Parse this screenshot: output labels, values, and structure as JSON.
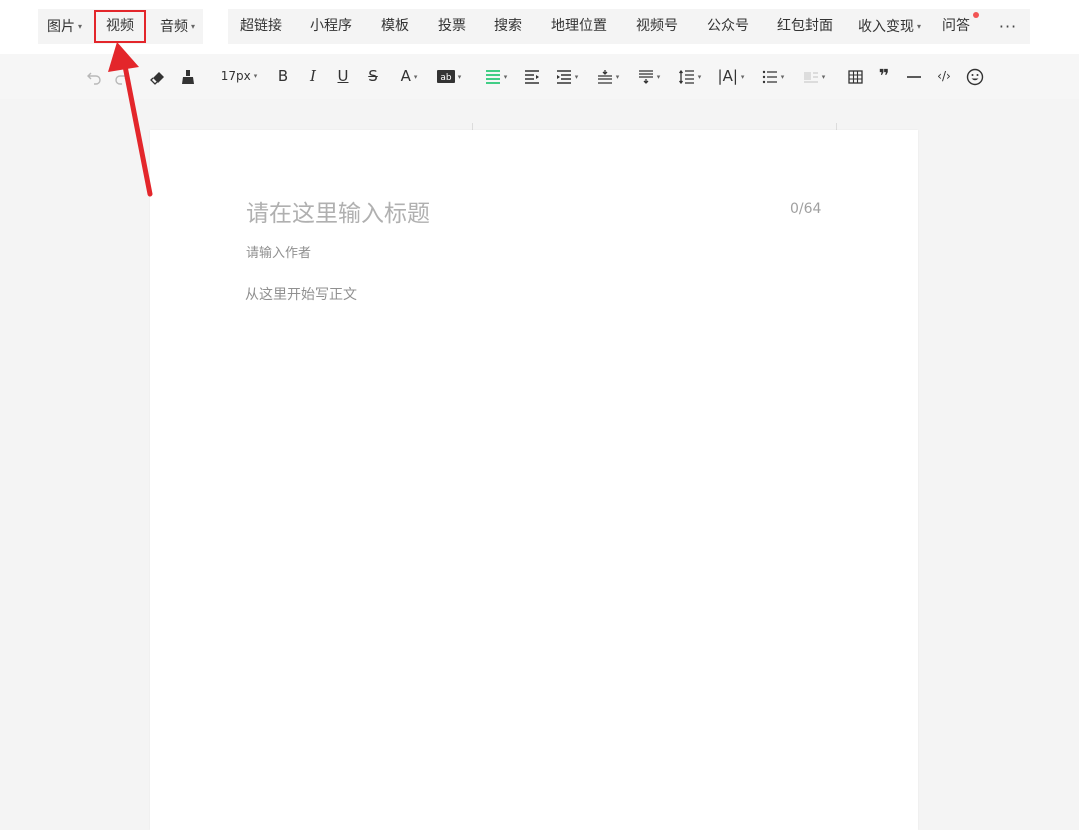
{
  "toolbar": {
    "image": "图片",
    "video": "视频",
    "audio": "音频",
    "hyperlink": "超链接",
    "mini_program": "小程序",
    "template": "模板",
    "vote": "投票",
    "search": "搜索",
    "location": "地理位置",
    "video_account": "视频号",
    "official_account": "公众号",
    "red_envelope_cover": "红包封面",
    "monetize": "收入变现",
    "qa": "问答",
    "more": "···"
  },
  "format": {
    "font_size": "17px"
  },
  "editor": {
    "title_placeholder": "请在这里输入标题",
    "title_counter": "0/64",
    "author_placeholder": "请输入作者",
    "body_placeholder": "从这里开始写正文"
  },
  "colors": {
    "highlight_box": "#e3262b",
    "arrow": "#e3262b",
    "notification_dot": "#f25454",
    "align_active": "#07c160"
  }
}
